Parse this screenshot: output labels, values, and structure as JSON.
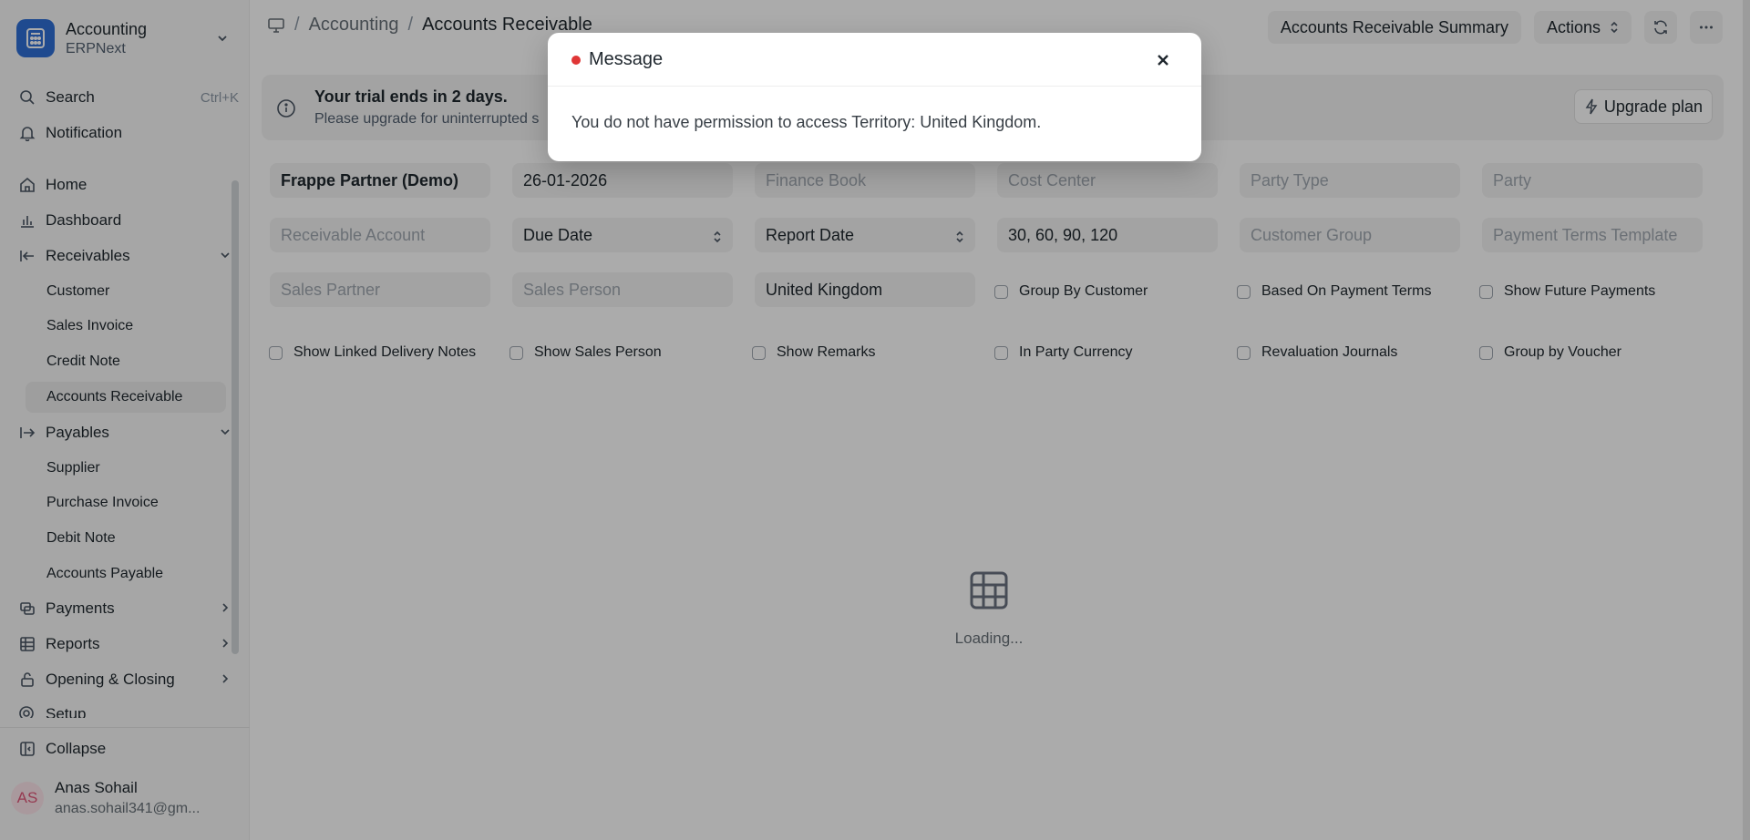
{
  "app": {
    "name": "Accounting",
    "sub": "ERPNext"
  },
  "sidebar": {
    "search_label": "Search",
    "search_shortcut": "Ctrl+K",
    "notification_label": "Notification",
    "items": [
      {
        "label": "Home",
        "icon": "home-icon"
      },
      {
        "label": "Dashboard",
        "icon": "chart-icon"
      },
      {
        "label": "Receivables",
        "icon": "arrow-left-bar-icon",
        "expanded": true
      },
      {
        "label": "Payables",
        "icon": "arrow-right-bar-icon",
        "expanded": true
      },
      {
        "label": "Payments",
        "icon": "payments-icon"
      },
      {
        "label": "Reports",
        "icon": "table-icon"
      },
      {
        "label": "Opening & Closing",
        "icon": "lock-open-icon"
      },
      {
        "label": "Setup",
        "icon": "gear-icon"
      }
    ],
    "receivables_sub": [
      "Customer",
      "Sales Invoice",
      "Credit Note",
      "Accounts Receivable"
    ],
    "payables_sub": [
      "Supplier",
      "Purchase Invoice",
      "Debit Note",
      "Accounts Payable"
    ],
    "collapse_label": "Collapse",
    "user": {
      "initials": "AS",
      "name": "Anas Sohail",
      "email": "anas.sohail341@gm..."
    }
  },
  "header": {
    "breadcrumb": [
      "Accounting",
      "Accounts Receivable"
    ],
    "summary_button": "Accounts Receivable Summary",
    "actions_button": "Actions"
  },
  "banner": {
    "title": "Your trial ends in 2 days.",
    "text": "Please upgrade for uninterrupted s",
    "upgrade_label": "Upgrade plan"
  },
  "filters": {
    "company": "Frappe Partner (Demo)",
    "date": "26-01-2026",
    "finance_book": "Finance Book",
    "cost_center": "Cost Center",
    "party_type": "Party Type",
    "party": "Party",
    "receivable_account": "Receivable Account",
    "ageing_based_on": "Due Date",
    "report_date": "Report Date",
    "ageing_range": "30, 60, 90, 120",
    "customer_group": "Customer Group",
    "payment_terms_template": "Payment Terms Template",
    "sales_partner": "Sales Partner",
    "sales_person": "Sales Person",
    "territory": "United Kingdom",
    "checks": [
      "Group By Customer",
      "Based On Payment Terms",
      "Show Future Payments",
      "Show Linked Delivery Notes",
      "Show Sales Person",
      "Show Remarks",
      "In Party Currency",
      "Revaluation Journals",
      "Group by Voucher"
    ]
  },
  "loading_text": "Loading...",
  "modal": {
    "title": "Message",
    "body": "You do not have permission to access Territory: United Kingdom.",
    "status_color": "#e03636"
  }
}
